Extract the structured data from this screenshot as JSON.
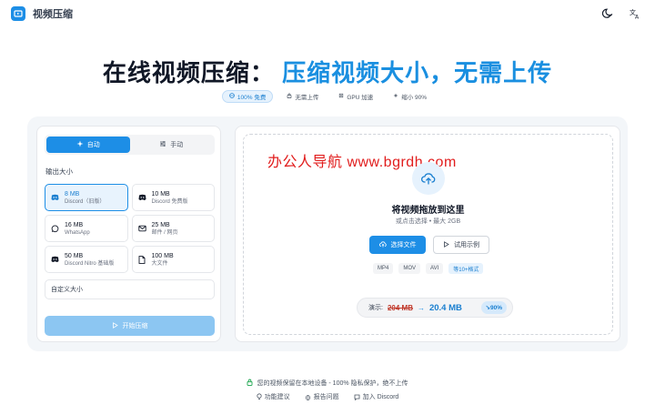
{
  "header": {
    "app_title": "视频压缩",
    "theme_icon": "moon-icon",
    "language_icon": "translate-icon"
  },
  "hero": {
    "title_part1": "在线视频压缩：",
    "title_part2": "压缩视频大小，无需上传"
  },
  "tags": [
    {
      "label": "100% 免费",
      "icon": "globe-icon"
    },
    {
      "label": "无需上传",
      "icon": "lock-icon"
    },
    {
      "label": "GPU 加速",
      "icon": "cpu-icon"
    },
    {
      "label": "缩小 90%",
      "icon": "sparkle-icon"
    }
  ],
  "modes": {
    "auto": "自动",
    "manual": "手动",
    "selected": "auto"
  },
  "output": {
    "label": "输出大小",
    "options": [
      {
        "size": "8 MB",
        "desc": "Discord（旧版）",
        "icon": "discord-icon",
        "selected": true
      },
      {
        "size": "10 MB",
        "desc": "Discord 免费版",
        "icon": "discord-icon",
        "selected": false
      },
      {
        "size": "16 MB",
        "desc": "WhatsApp",
        "icon": "whatsapp-icon",
        "selected": false
      },
      {
        "size": "25 MB",
        "desc": "邮件 / 网页",
        "icon": "mail-icon",
        "selected": false
      },
      {
        "size": "50 MB",
        "desc": "Discord Nitro 基础版",
        "icon": "discord-icon",
        "selected": false
      },
      {
        "size": "100 MB",
        "desc": "大文件",
        "icon": "file-icon",
        "selected": false
      }
    ],
    "custom_label": "自定义大小",
    "start_label": "开始压缩"
  },
  "dropzone": {
    "watermark": "办公人导航  www.bgrdh.com",
    "title": "将视频拖放到这里",
    "subtitle": "或点击选择 • 最大 2GB",
    "choose_label": "选择文件",
    "example_label": "试用示例",
    "formats": [
      "MP4",
      "MOV",
      "AVI",
      "等10+格式"
    ]
  },
  "demo": {
    "label": "演示:",
    "before": "204 MB",
    "after": "20.4 MB",
    "reduction": "↘90%"
  },
  "privacy": "您的视频保留在本地设备 - 100% 隐私保护，绝不上传",
  "footer": {
    "feature": "功能建议",
    "report": "报告问题",
    "discord": "加入 Discord"
  },
  "colors": {
    "accent": "#1d8ee6",
    "accent_light": "#e6f2fd",
    "watermark": "#e11d1d",
    "strike": "#c0392b"
  }
}
